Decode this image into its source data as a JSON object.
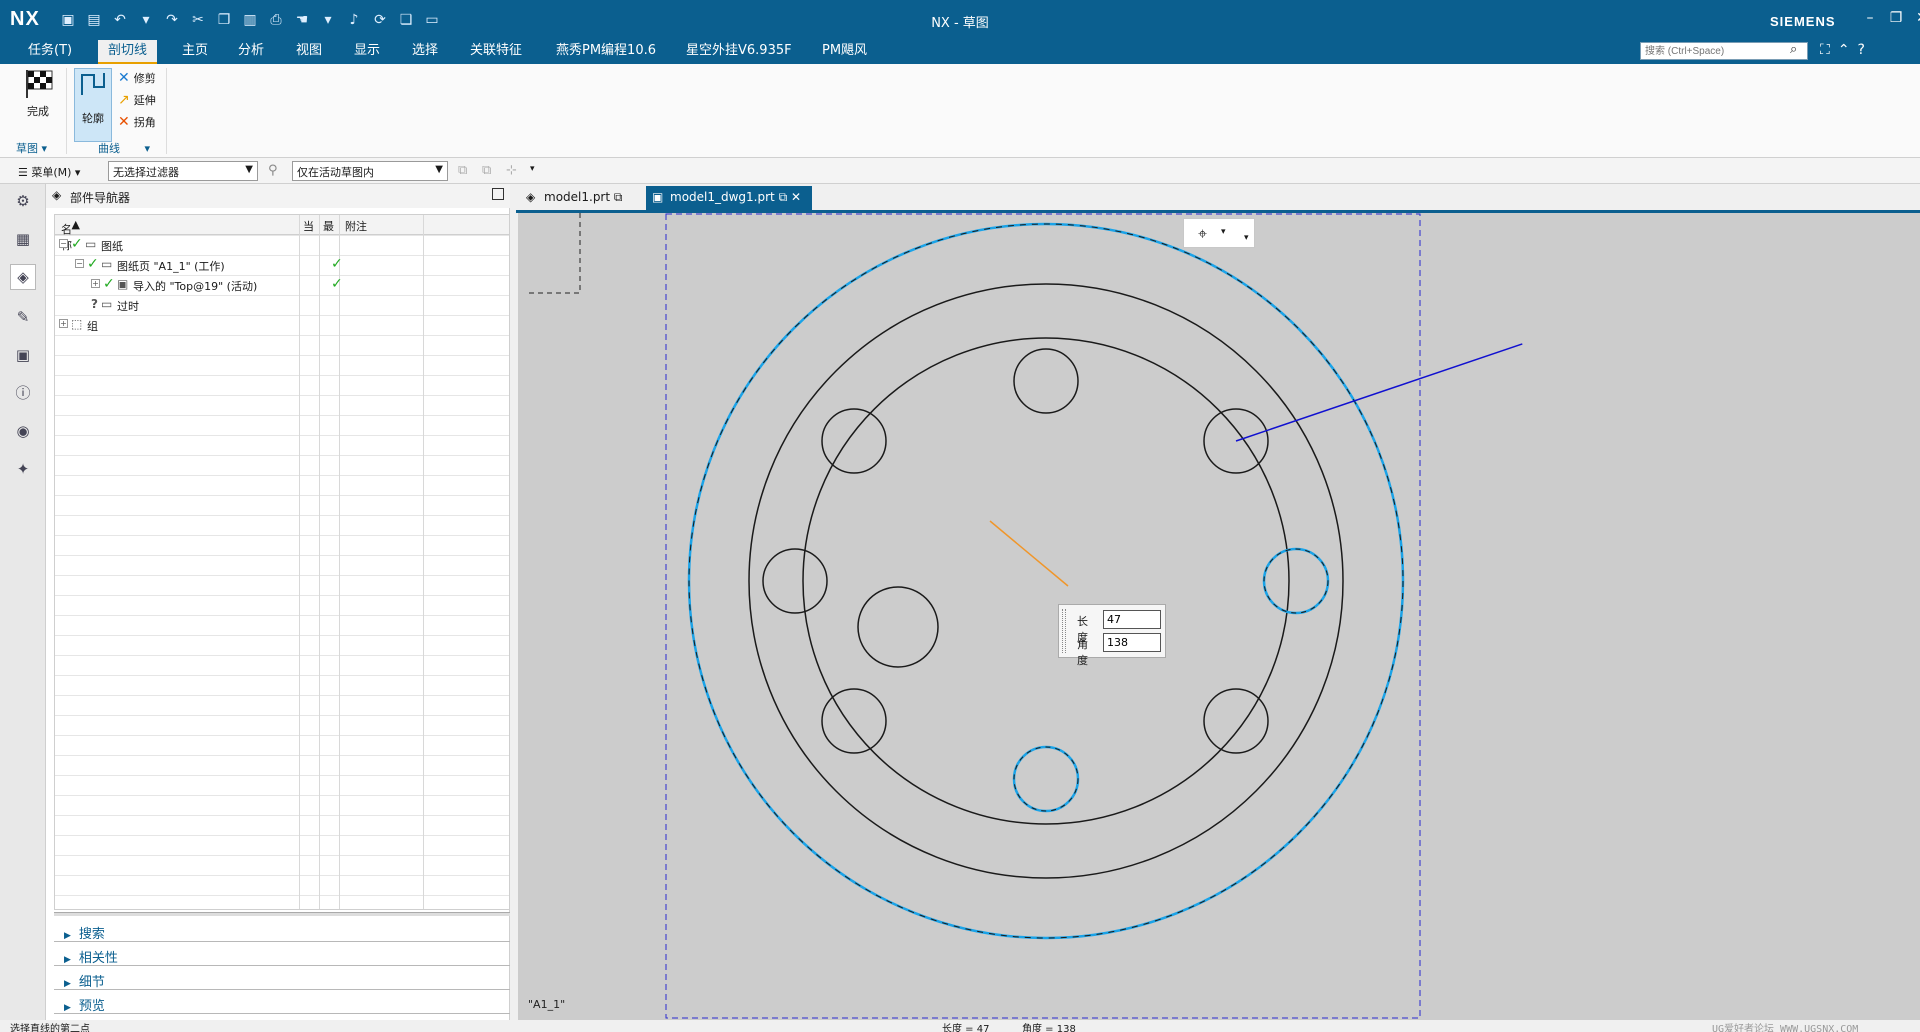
{
  "app": {
    "logo": "NX",
    "window_title": "NX - 草图",
    "brand": "SIEMENS"
  },
  "menu_tabs": [
    {
      "label": "任务(T)",
      "active": false
    },
    {
      "label": "剖切线",
      "active": true
    },
    {
      "label": "主页",
      "active": false
    },
    {
      "label": "分析",
      "active": false
    },
    {
      "label": "视图",
      "active": false
    },
    {
      "label": "显示",
      "active": false
    },
    {
      "label": "选择",
      "active": false
    },
    {
      "label": "关联特征",
      "active": false
    },
    {
      "label": "燕秀PM编程10.6",
      "active": false
    },
    {
      "label": "星空外挂V6.935F",
      "active": false
    },
    {
      "label": "PM飓风",
      "active": false
    }
  ],
  "search": {
    "placeholder": "搜索 (Ctrl+Space)"
  },
  "ribbon": {
    "finish_label": "完成",
    "profile_label": "轮廓",
    "trim_label": "修剪",
    "extend_label": "延伸",
    "corner_label": "拐角",
    "group_sketch": "草图",
    "group_curve": "曲线"
  },
  "toolbar2": {
    "menu_label": "菜单(M)",
    "filter_value": "无选择过滤器",
    "scope_value": "仅在活动草图内"
  },
  "navigator": {
    "title": "部件导航器",
    "columns": {
      "name": "名称",
      "current": "当",
      "latest": "最",
      "note": "附注"
    },
    "rows": [
      {
        "label": "图纸",
        "latest": false
      },
      {
        "label": "图纸页 \"A1_1\" (工作)",
        "latest": true
      },
      {
        "label": "导入的 \"Top@19\" (活动)",
        "latest": true
      },
      {
        "label": "过时",
        "latest": false
      },
      {
        "label": "组",
        "latest": false
      }
    ],
    "sections": [
      "搜索",
      "相关性",
      "细节",
      "预览"
    ]
  },
  "doc_tabs": [
    {
      "label": "model1.prt",
      "active": false
    },
    {
      "label": "model1_dwg1.prt",
      "active": true
    }
  ],
  "canvas": {
    "sheet_name": "\"A1_1\"",
    "colors": {
      "background": "#cccccc",
      "highlight": "#1aa3e8",
      "line": "#1a1a1a",
      "active_line": "#1010d0",
      "preview": "#f0962a",
      "border": "#2a2ad0"
    }
  },
  "dynamic_input": {
    "length_label": "长度",
    "length_value": "47",
    "angle_label": "角度",
    "angle_value": "138"
  },
  "status": {
    "prompt": "选择直线的第二点",
    "length_readout": "长度 = 47",
    "angle_readout": "角度 = 138",
    "watermark": "UG爱好者论坛 WWW.UGSNX.COM"
  }
}
